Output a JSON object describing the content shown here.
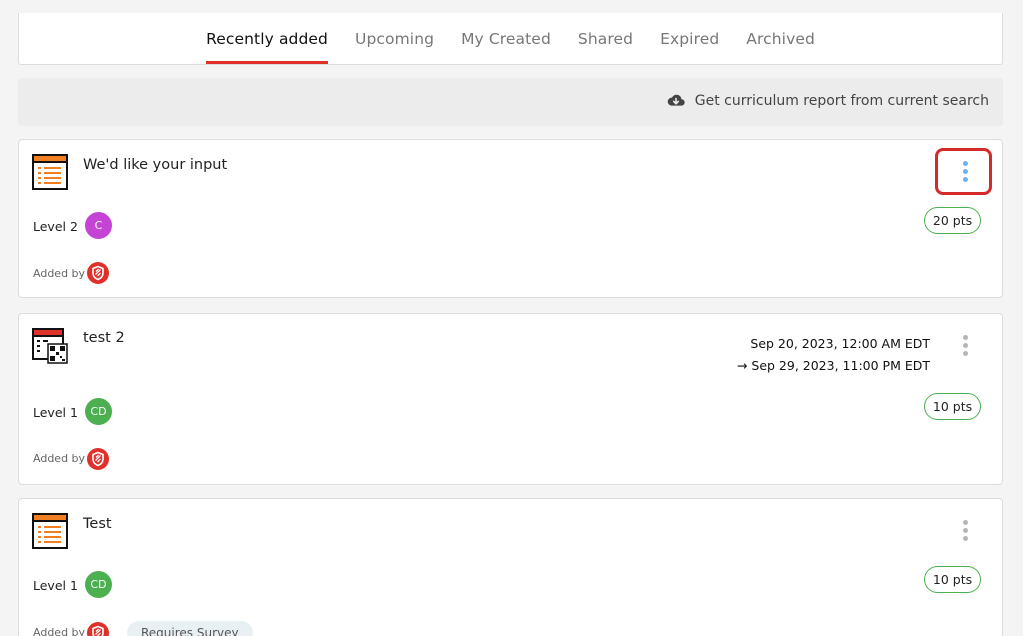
{
  "tabs": [
    {
      "label": "Recently added",
      "active": true
    },
    {
      "label": "Upcoming",
      "active": false
    },
    {
      "label": "My Created",
      "active": false
    },
    {
      "label": "Shared",
      "active": false
    },
    {
      "label": "Expired",
      "active": false
    },
    {
      "label": "Archived",
      "active": false
    }
  ],
  "report": {
    "label": "Get curriculum report from current search",
    "icon": "cloud-download-icon"
  },
  "items": [
    {
      "title": "We'd like your input",
      "level": "Level 2",
      "avatar": {
        "text": "C",
        "color": "#c544d6"
      },
      "added_by": "Added by",
      "points": "20 pts",
      "icon": "survey-list-icon",
      "menu_highlighted": true
    },
    {
      "title": "test 2",
      "level": "Level 1",
      "avatar": {
        "text": "CD",
        "color": "#4caf50"
      },
      "added_by": "Added by",
      "points": "10 pts",
      "icon": "qr-checkin-icon",
      "start": "Sep 20, 2023, 12:00 AM EDT",
      "end": "Sep 29, 2023, 11:00 PM EDT",
      "end_arrow": "→"
    },
    {
      "title": "Test",
      "level": "Level 1",
      "avatar": {
        "text": "CD",
        "color": "#4caf50"
      },
      "added_by": "Added by",
      "points": "10 pts",
      "icon": "survey-list-icon",
      "tag": "Requires Survey"
    }
  ],
  "colors": {
    "accent": "#e0302a",
    "points_border": "#4caf50",
    "menu_highlight": "#66b6f2",
    "highlight_box": "#d52a2a"
  }
}
